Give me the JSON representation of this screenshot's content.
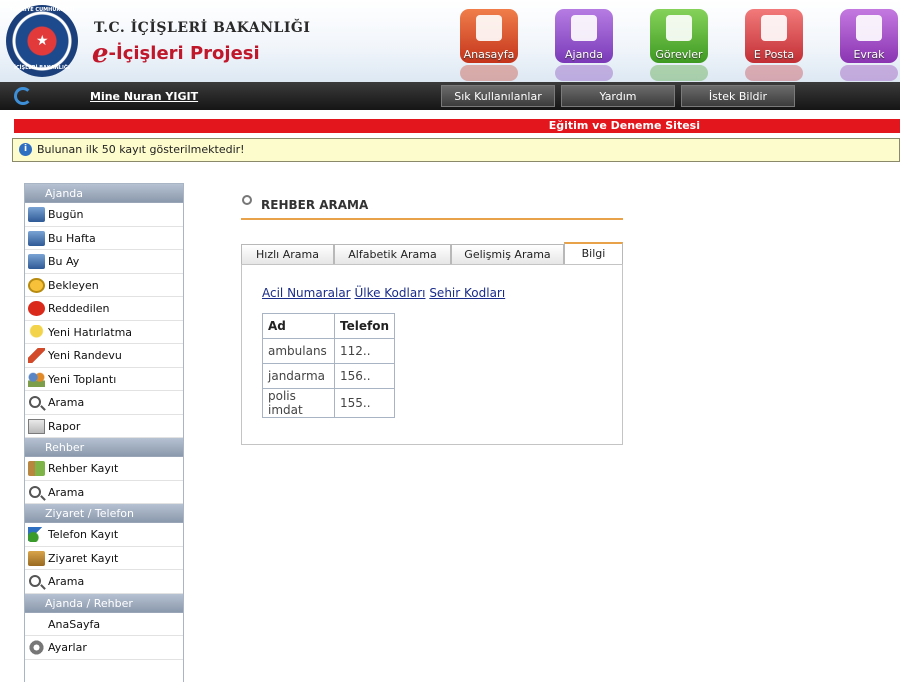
{
  "header": {
    "seal_top_text": "TÜRKİYE CUMHURİYETİ",
    "seal_bottom_text": "İÇİŞLERİ BAKANLIĞI",
    "ministry": "T.C. İÇİŞLERİ BAKANLIĞI",
    "project_e": "e",
    "project_rest": "-İçişleri Projesi",
    "icons": [
      {
        "label": "Anasayfa",
        "icon": "home-icon"
      },
      {
        "label": "Ajanda",
        "icon": "agenda-icon"
      },
      {
        "label": "Görevler",
        "icon": "tasks-icon"
      },
      {
        "label": "E Posta",
        "icon": "mail-icon"
      },
      {
        "label": "Evrak",
        "icon": "document-icon"
      }
    ]
  },
  "navbar": {
    "user": "Mine Nuran YIGIT",
    "buttons": [
      "Sık Kullanılanlar",
      "Yardım",
      "İstek Bildir"
    ]
  },
  "site_banner": "Eğitim ve Deneme Sitesi",
  "info": {
    "icon": "info-icon",
    "text": "Bulunan ilk 50 kayıt gösterilmektedir!"
  },
  "sidebar": {
    "sections": [
      {
        "title": "Ajanda",
        "items": [
          "Bugün",
          "Bu Hafta",
          "Bu Ay",
          "Bekleyen",
          "Reddedilen",
          "Yeni Hatırlatma",
          "Yeni Randevu",
          "Yeni Toplantı",
          "Arama",
          "Rapor"
        ]
      },
      {
        "title": "Rehber",
        "items": [
          "Rehber Kayıt",
          "Arama"
        ]
      },
      {
        "title": "Ziyaret / Telefon",
        "items": [
          "Telefon Kayıt",
          "Ziyaret Kayıt",
          "Arama"
        ]
      },
      {
        "title": "Ajanda / Rehber",
        "items": [
          "AnaSayfa",
          "Ayarlar"
        ]
      }
    ]
  },
  "main": {
    "title": "REHBER ARAMA",
    "tabs": [
      "Hızlı Arama",
      "Alfabetik Arama",
      "Gelişmiş Arama",
      "Bilgi"
    ],
    "active_tab": "Bilgi",
    "links": [
      "Acil Numaralar",
      "Ülke Kodları",
      "Sehir Kodları"
    ],
    "table": {
      "headers": [
        "Ad",
        "Telefon"
      ],
      "rows": [
        [
          "ambulans",
          "112.."
        ],
        [
          "jandarma",
          "156.."
        ],
        [
          "polis imdat",
          "155.."
        ]
      ]
    }
  },
  "colors": {
    "accent_orange": "#e8a24a",
    "banner_red": "#e3161e",
    "info_yellow": "#fdfccc",
    "brand_red": "#c0172b"
  }
}
